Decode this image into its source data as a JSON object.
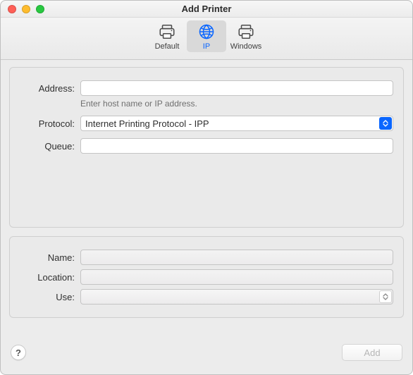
{
  "window": {
    "title": "Add Printer"
  },
  "toolbar": {
    "items": [
      {
        "label": "Default",
        "selected": false,
        "icon": "printer"
      },
      {
        "label": "IP",
        "selected": true,
        "icon": "globe"
      },
      {
        "label": "Windows",
        "selected": false,
        "icon": "printer"
      }
    ]
  },
  "form_top": {
    "address": {
      "label": "Address:",
      "value": "",
      "hint": "Enter host name or IP address."
    },
    "protocol": {
      "label": "Protocol:",
      "value": "Internet Printing Protocol - IPP"
    },
    "queue": {
      "label": "Queue:",
      "value": ""
    }
  },
  "form_bottom": {
    "name": {
      "label": "Name:",
      "value": ""
    },
    "location": {
      "label": "Location:",
      "value": ""
    },
    "use": {
      "label": "Use:",
      "value": ""
    }
  },
  "footer": {
    "help_label": "?",
    "add_label": "Add"
  }
}
